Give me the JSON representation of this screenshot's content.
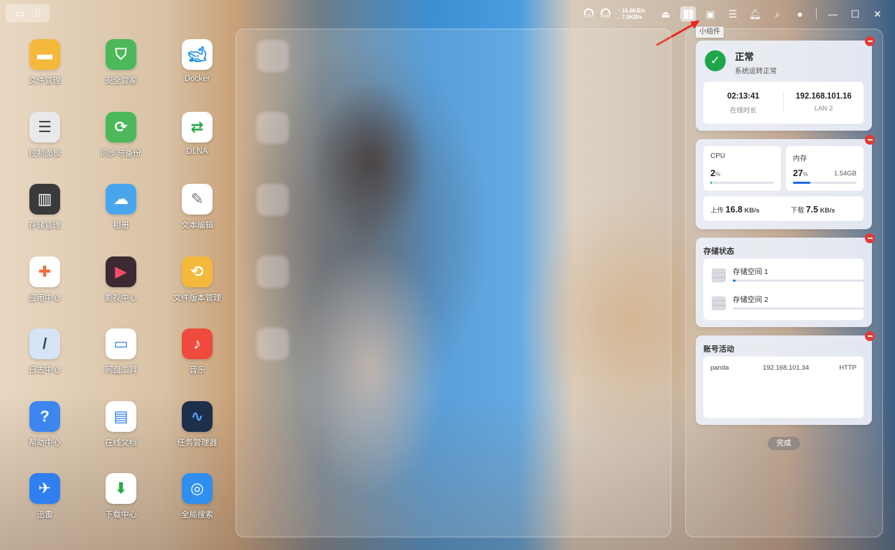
{
  "topbar": {
    "left_icons": [
      "desktop-icon",
      "grid-icon"
    ],
    "gauges": [
      {
        "label": "CPU"
      },
      {
        "label": "RAM"
      }
    ],
    "net": {
      "up": "↑ 16.8KB/s",
      "down": "↓ 7.5KB/s"
    },
    "tooltip": "小组件"
  },
  "apps": [
    {
      "label": "文件管理",
      "icon": "folder-icon",
      "color": "#f4b93a"
    },
    {
      "label": "安全管家",
      "icon": "shield-icon",
      "color": "#4cb85a"
    },
    {
      "label": "Docker",
      "icon": "docker-icon",
      "color": "#ffffff"
    },
    {
      "label": "控制面板",
      "icon": "sliders-icon",
      "color": "#e9e9ec"
    },
    {
      "label": "同步与备份",
      "icon": "sync-icon",
      "color": "#4cb85a"
    },
    {
      "label": "DLNA",
      "icon": "dlna-icon",
      "color": "#ffffff"
    },
    {
      "label": "存储管理",
      "icon": "storage-icon",
      "color": "#3a3a3c"
    },
    {
      "label": "相册",
      "icon": "photo-icon",
      "color": "#4aa6ec"
    },
    {
      "label": "文本编辑",
      "icon": "text-editor-icon",
      "color": "#ffffff"
    },
    {
      "label": "应用中心",
      "icon": "app-center-icon",
      "color": "#ffffff"
    },
    {
      "label": "影视中心",
      "icon": "video-icon",
      "color": "#3c2a33"
    },
    {
      "label": "文件版本管理",
      "icon": "version-icon",
      "color": "#f4b93a"
    },
    {
      "label": "日志中心",
      "icon": "logs-icon",
      "color": "#d6e4f5"
    },
    {
      "label": "网盘工具",
      "icon": "cloud-drive-icon",
      "color": "#ffffff"
    },
    {
      "label": "音乐",
      "icon": "music-icon",
      "color": "#ef4a3e"
    },
    {
      "label": "帮助中心",
      "icon": "help-icon",
      "color": "#3d86f0"
    },
    {
      "label": "在线文档",
      "icon": "document-icon",
      "color": "#ffffff"
    },
    {
      "label": "任务管理器",
      "icon": "task-manager-icon",
      "color": "#1d2f4a"
    },
    {
      "label": "迅雷",
      "icon": "thunder-icon",
      "color": "#2f7ff0"
    },
    {
      "label": "下载中心",
      "icon": "download-icon",
      "color": "#ffffff"
    },
    {
      "label": "全局搜索",
      "icon": "search-app-icon",
      "color": "#2f8ff0"
    }
  ],
  "widgets": {
    "status": {
      "title": "正常",
      "subtitle": "系统运转正常",
      "uptime_value": "02:13:41",
      "uptime_label": "在线时长",
      "ip_value": "192.168.101.16",
      "ip_label": "LAN 2"
    },
    "resources": {
      "cpu_label": "CPU",
      "cpu_value": "2",
      "cpu_unit": "%",
      "cpu_fraction": 0.02,
      "mem_label": "内存",
      "mem_value": "27",
      "mem_unit": "%",
      "mem_fraction": 0.27,
      "mem_used": "1.54GB",
      "up_label": "上传",
      "up_value": "16.8",
      "up_unit": "KB/s",
      "down_label": "下载",
      "down_value": "7.5",
      "down_unit": "KB/s"
    },
    "storage": {
      "title": "存储状态",
      "pools": [
        {
          "name": "存储空间 1",
          "fraction": 0.02
        },
        {
          "name": "存储空间 2",
          "fraction": 0.0
        }
      ]
    },
    "accounts": {
      "title": "账号活动",
      "rows": [
        {
          "user": "panda",
          "ip": "192.168.101.34",
          "protocol": "HTTP"
        }
      ]
    }
  },
  "done_button": "完成",
  "colors": {
    "accent": "#1e66e6",
    "ok": "#1fa64a",
    "remove": "#e53935"
  }
}
